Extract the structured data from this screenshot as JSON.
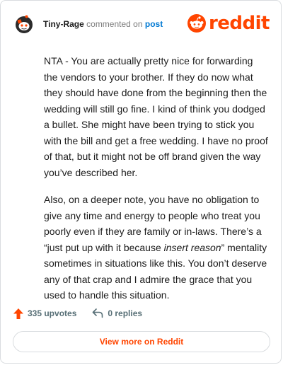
{
  "comment": {
    "author": "Tiny-Rage",
    "commented_on_text": "commented on",
    "post_link_text": "post",
    "paragraph_1": "NTA - You are actually pretty nice for forwarding the vendors to your brother. If they do now what they should have done from the beginning then the wedding will still go fine. I kind of think you dodged a bullet. She might have been trying to stick you with the bill and get a free wedding. I have no proof of that, but it might not be off brand given the way you’ve described her.",
    "paragraph_2_start": "Also, on a deeper note, you have no obligation to give any time and energy to people who treat you poorly even if they are family or in-laws. There’s a “just put up with it because ",
    "paragraph_2_italic": "insert reason",
    "paragraph_2_end": "” mentality sometimes in situations like this. You don’t deserve any of that crap and I admire the grace that you used to handle this situation."
  },
  "brand": {
    "name": "reddit",
    "icon": "reddit-snoo-icon",
    "color": "#ff4500"
  },
  "stats": {
    "upvotes": "335 upvotes",
    "replies": "0 replies",
    "upvote_icon": "upvote-arrow-icon",
    "reply_icon": "reply-arrow-icon"
  },
  "actions": {
    "view_more": "View more on Reddit"
  }
}
